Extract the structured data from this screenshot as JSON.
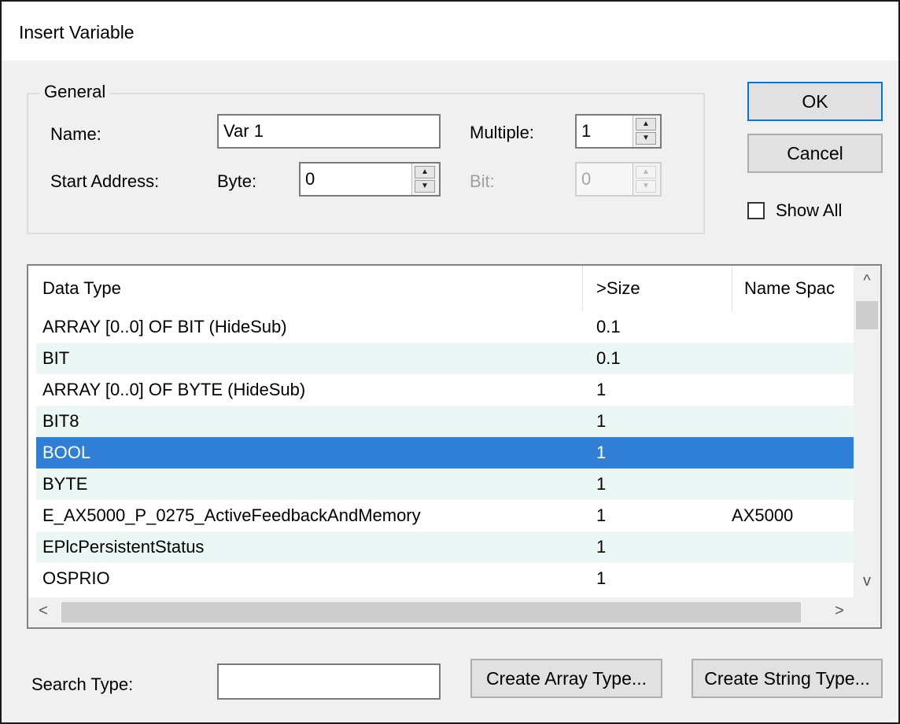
{
  "window": {
    "title": "Insert Variable"
  },
  "general": {
    "legend": "General",
    "name_label": "Name:",
    "name_value": "Var 1",
    "multiple_label": "Multiple:",
    "multiple_value": "1",
    "start_address_label": "Start Address:",
    "byte_label": "Byte:",
    "byte_value": "0",
    "bit_label": "Bit:",
    "bit_value": "0"
  },
  "buttons": {
    "ok": "OK",
    "cancel": "Cancel",
    "create_array": "Create Array Type...",
    "create_string": "Create String Type..."
  },
  "show_all": {
    "label": "Show All",
    "checked": false
  },
  "list": {
    "columns": [
      "Data Type",
      ">Size",
      "Name Spac"
    ],
    "rows": [
      {
        "type": "ARRAY [0..0] OF BIT (HideSub)",
        "size": "0.1",
        "ns": ""
      },
      {
        "type": "BIT",
        "size": "0.1",
        "ns": ""
      },
      {
        "type": "ARRAY [0..0] OF BYTE (HideSub)",
        "size": "1",
        "ns": ""
      },
      {
        "type": "BIT8",
        "size": "1",
        "ns": ""
      },
      {
        "type": "BOOL",
        "size": "1",
        "ns": ""
      },
      {
        "type": "BYTE",
        "size": "1",
        "ns": ""
      },
      {
        "type": "E_AX5000_P_0275_ActiveFeedbackAndMemory",
        "size": "1",
        "ns": "AX5000"
      },
      {
        "type": "EPlcPersistentStatus",
        "size": "1",
        "ns": ""
      },
      {
        "type": "OSPRIO",
        "size": "1",
        "ns": ""
      }
    ],
    "selected_index": 4
  },
  "search": {
    "label": "Search Type:",
    "value": ""
  },
  "icons": {
    "spin_up": "▲",
    "spin_down": "▼",
    "scroll_up": "^",
    "scroll_down": "v",
    "scroll_left": "<",
    "scroll_right": ">"
  },
  "colors": {
    "selection": "#2f7fd6",
    "alt_row": "#eaf7f4",
    "default_button_border": "#0078d7"
  }
}
